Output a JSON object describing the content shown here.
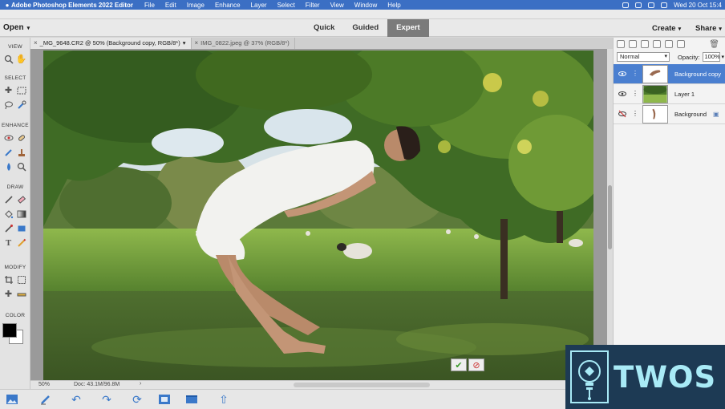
{
  "menubar": {
    "app_name": "Adobe Photoshop Elements 2022 Editor",
    "items": [
      "File",
      "Edit",
      "Image",
      "Enhance",
      "Layer",
      "Select",
      "Filter",
      "View",
      "Window",
      "Help"
    ],
    "clock": "Wed 20 Oct  15:4"
  },
  "modebar": {
    "open_label": "Open",
    "tabs": [
      {
        "label": "Quick",
        "active": false
      },
      {
        "label": "Guided",
        "active": false
      },
      {
        "label": "Expert",
        "active": true
      }
    ],
    "create_label": "Create",
    "share_label": "Share"
  },
  "doc_tabs": [
    {
      "label": "_MG_9648.CR2 @ 50% (Background copy, RGB/8*)",
      "active": true
    },
    {
      "label": "IMG_0822.jpeg @ 37% (RGB/8*)",
      "active": false
    }
  ],
  "toolbox": {
    "sections": [
      "VIEW",
      "SELECT",
      "ENHANCE",
      "DRAW",
      "MODIFY",
      "COLOR"
    ],
    "foreground_color": "#000000",
    "background_color": "#ffffff"
  },
  "status": {
    "zoom": "50%",
    "doc_size": "Doc: 43.1M/96.8M"
  },
  "layers_panel": {
    "blend_mode": "Normal",
    "opacity_label": "Opacity:",
    "opacity_value": "100%",
    "layers": [
      {
        "name": "Background copy",
        "selected": true,
        "visible": true
      },
      {
        "name": "Layer 1",
        "selected": false,
        "visible": true
      },
      {
        "name": "Background",
        "selected": false,
        "visible": false
      }
    ]
  },
  "watermark": {
    "text": "TWOS"
  },
  "colors": {
    "menubar": "#3b6fc4",
    "active_mode_tab": "#7b7b7b",
    "selected_layer": "#4a7fd0",
    "watermark_bg": "#1d3a54",
    "watermark_text": "#a8eaf6"
  }
}
